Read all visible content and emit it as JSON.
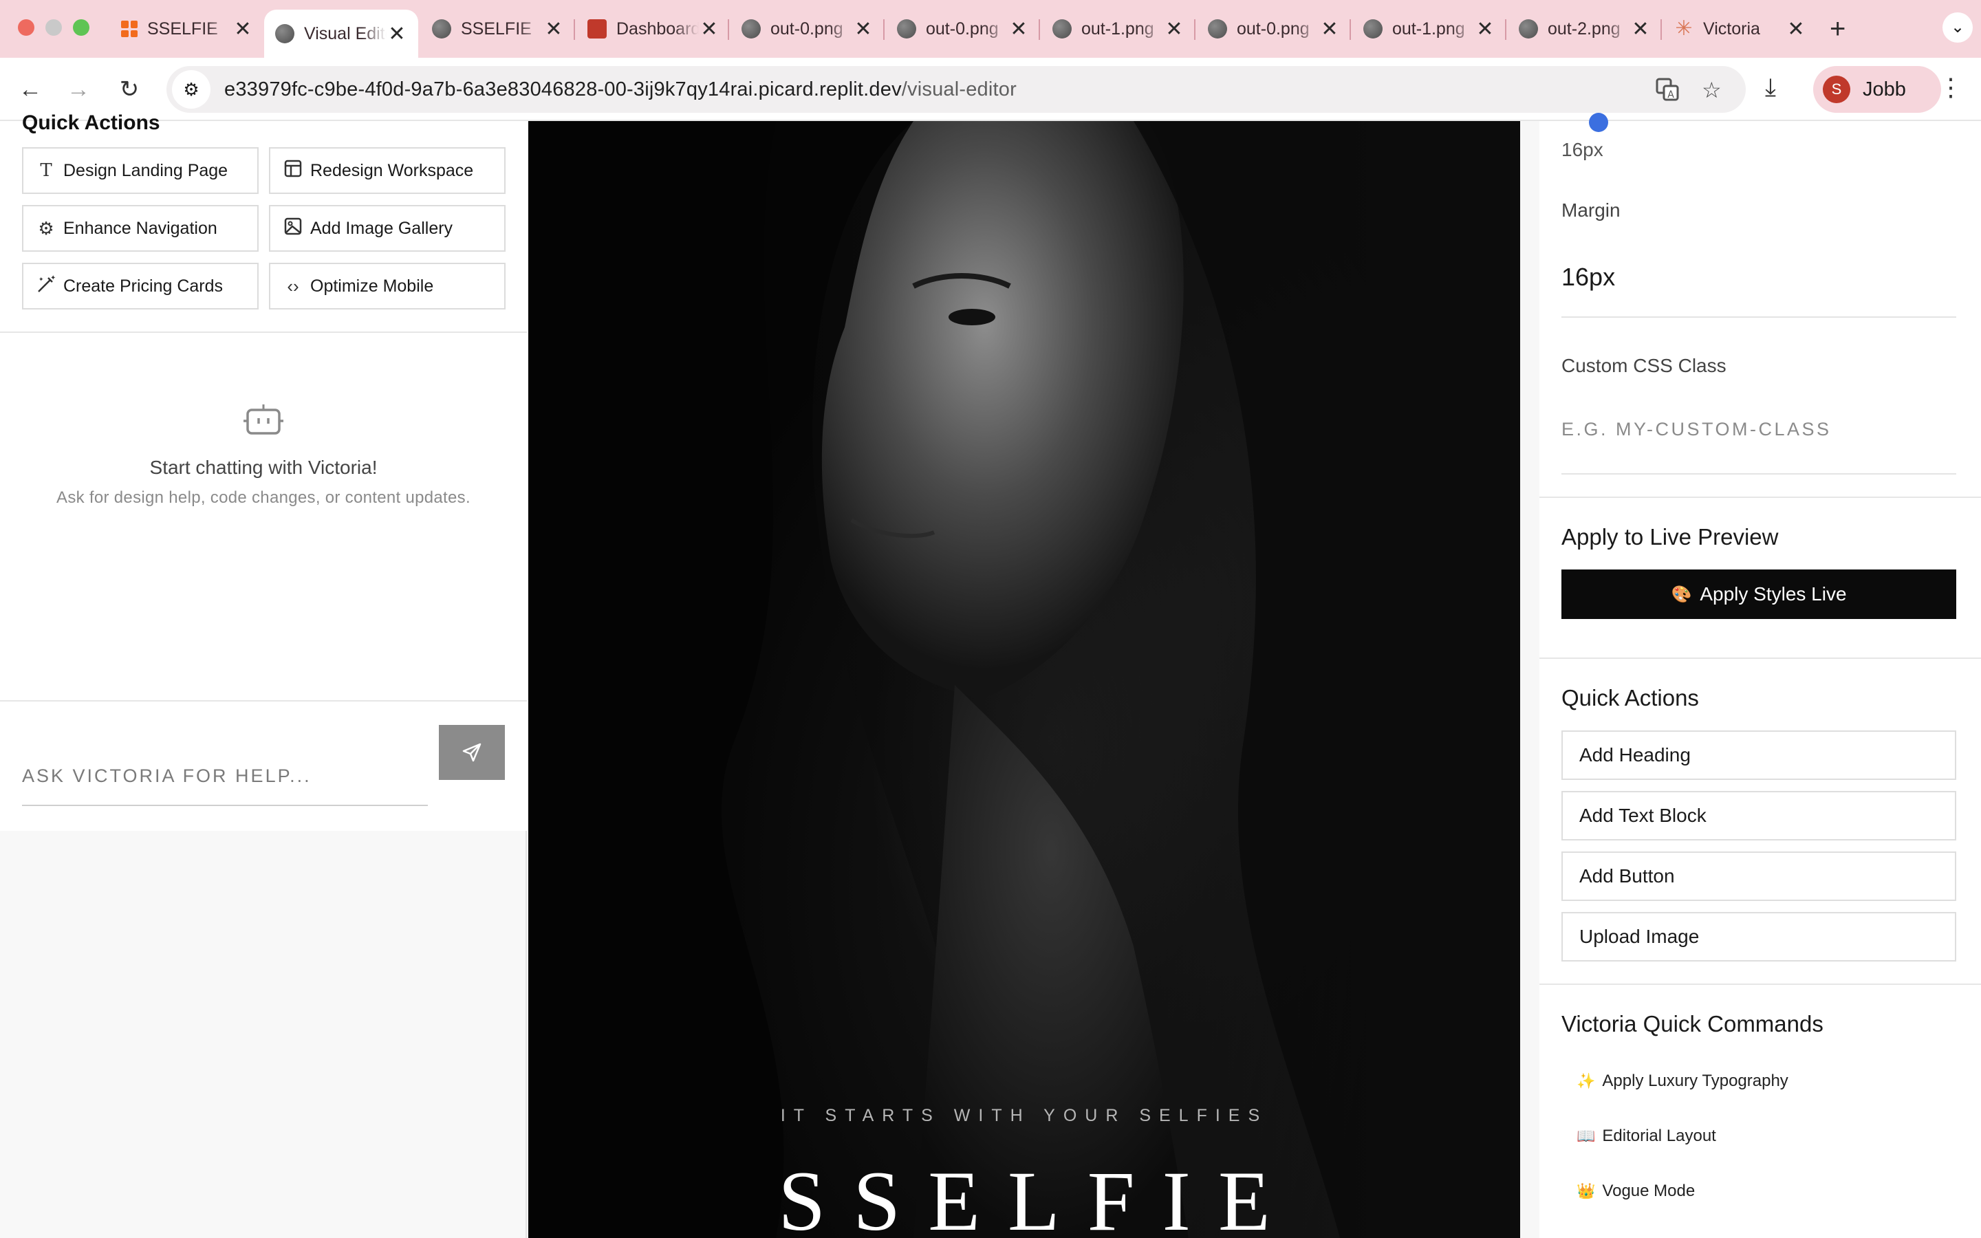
{
  "browser": {
    "tabs": [
      {
        "title": "SSELFIE",
        "icon": "sselfie-favicon",
        "active": false
      },
      {
        "title": "Visual Editor",
        "icon": "globe-icon",
        "active": true
      },
      {
        "title": "SSELFIE",
        "icon": "globe-icon",
        "active": false
      },
      {
        "title": "Dashboard",
        "icon": "dashboard-favicon",
        "active": false
      },
      {
        "title": "out-0.png",
        "icon": "globe-icon",
        "active": false
      },
      {
        "title": "out-0.png",
        "icon": "globe-icon",
        "active": false
      },
      {
        "title": "out-1.png",
        "icon": "globe-icon",
        "active": false
      },
      {
        "title": "out-0.png",
        "icon": "globe-icon",
        "active": false
      },
      {
        "title": "out-1.png",
        "icon": "globe-icon",
        "active": false
      },
      {
        "title": "out-2.png",
        "icon": "globe-icon",
        "active": false
      },
      {
        "title": "Victoria",
        "icon": "claude-favicon",
        "active": false
      }
    ],
    "url_host": "e33979fc-c9be-4f0d-9a7b-6a3e83046828-00-3ij9k7qy14rai.picard.replit.dev",
    "url_path": "/visual-editor",
    "profile_initial": "S",
    "profile_name": "Jobb",
    "tab_close_glyph": "✕",
    "new_tab_glyph": "+",
    "colors": {
      "tab_strip": "#f6d6dc",
      "profile_badge": "#c0392b"
    }
  },
  "left_panel": {
    "quick_actions_title": "Quick Actions",
    "quick_actions": [
      {
        "label": "Design Landing Page",
        "icon": "text-type-icon"
      },
      {
        "label": "Redesign Workspace",
        "icon": "layout-icon"
      },
      {
        "label": "Enhance Navigation",
        "icon": "gear-icon"
      },
      {
        "label": "Add Image Gallery",
        "icon": "image-icon"
      },
      {
        "label": "Create Pricing Cards",
        "icon": "magic-wand-icon"
      },
      {
        "label": "Optimize Mobile",
        "icon": "code-icon"
      }
    ],
    "chat_empty_title": "Start chatting with Victoria!",
    "chat_empty_subtitle": "Ask for design help, code changes, or content updates.",
    "chat_placeholder": "ASK VICTORIA FOR HELP...",
    "send_icon": "send-icon"
  },
  "preview": {
    "tagline": "IT STARTS WITH YOUR SELFIES",
    "title": "SSELFIE"
  },
  "right_panel": {
    "padding_value": "16px",
    "margin_label": "Margin",
    "margin_value": "16px",
    "css_class_label": "Custom CSS Class",
    "css_class_placeholder": "E.G. MY-CUSTOM-CLASS",
    "apply_heading": "Apply to Live Preview",
    "apply_button_emoji": "🎨",
    "apply_button_label": "Apply Styles Live",
    "quick_actions_heading": "Quick Actions",
    "quick_actions": [
      "Add Heading",
      "Add Text Block",
      "Add Button",
      "Upload Image"
    ],
    "commands_heading": "Victoria Quick Commands",
    "commands": [
      {
        "emoji": "✨",
        "label": "Apply Luxury Typography"
      },
      {
        "emoji": "📖",
        "label": "Editorial Layout"
      },
      {
        "emoji": "👑",
        "label": "Vogue Mode"
      }
    ]
  }
}
